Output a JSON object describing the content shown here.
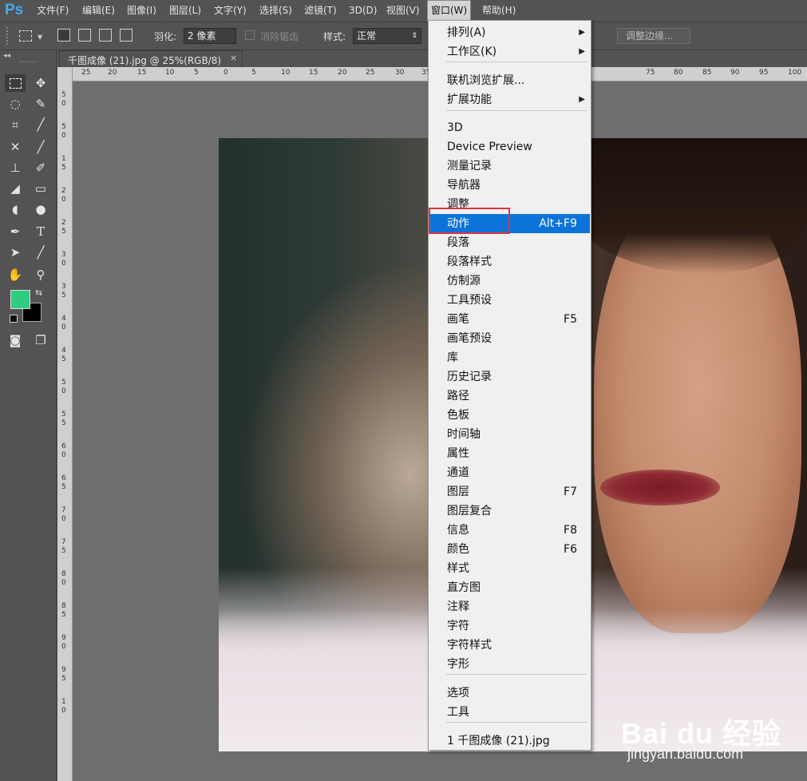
{
  "app": {
    "logo": "Ps"
  },
  "menubar": {
    "items": [
      "文件(F)",
      "编辑(E)",
      "图像(I)",
      "图层(L)",
      "文字(Y)",
      "选择(S)",
      "滤镜(T)",
      "3D(D)",
      "视图(V)",
      "窗口(W)",
      "帮助(H)"
    ],
    "active_index": 9
  },
  "options_bar": {
    "feather_label": "羽化:",
    "feather_value": "2 像素",
    "antialias_label": "消除锯齿",
    "style_label": "样式:",
    "style_value": "正常",
    "refine_edge_button": "调整边缘..."
  },
  "document_tab": {
    "title": "千图成像 (21).jpg @ 25%(RGB/8)",
    "close_symbol": "×"
  },
  "ruler": {
    "h_labels": [
      "25",
      "20",
      "15",
      "10",
      "5",
      "0",
      "5",
      "10",
      "15",
      "20",
      "25",
      "30",
      "35",
      "75",
      "80",
      "85",
      "90",
      "95",
      "100"
    ],
    "v_labels": [
      "5",
      "0",
      "5",
      "0",
      "1",
      "5",
      "2",
      "0",
      "2",
      "5",
      "3",
      "0",
      "3",
      "5",
      "4",
      "0",
      "4",
      "5",
      "5",
      "0",
      "5",
      "5",
      "6",
      "0",
      "6",
      "5",
      "7",
      "0",
      "7",
      "5",
      "8",
      "0",
      "8",
      "5",
      "9",
      "0",
      "9",
      "5",
      "1",
      "0"
    ]
  },
  "window_menu": {
    "items": [
      {
        "label": "排列(A)",
        "submenu": true
      },
      {
        "label": "工作区(K)",
        "submenu": true
      },
      {
        "label": "联机浏览扩展..."
      },
      {
        "label": "扩展功能",
        "submenu": true
      },
      {
        "label": "3D"
      },
      {
        "label": "Device Preview"
      },
      {
        "label": "测量记录"
      },
      {
        "label": "导航器"
      },
      {
        "label": "调整"
      },
      {
        "label": "动作",
        "shortcut": "Alt+F9",
        "highlighted": true
      },
      {
        "label": "段落"
      },
      {
        "label": "段落样式"
      },
      {
        "label": "仿制源"
      },
      {
        "label": "工具预设"
      },
      {
        "label": "画笔",
        "shortcut": "F5"
      },
      {
        "label": "画笔预设"
      },
      {
        "label": "库"
      },
      {
        "label": "历史记录"
      },
      {
        "label": "路径"
      },
      {
        "label": "色板"
      },
      {
        "label": "时间轴"
      },
      {
        "label": "属性"
      },
      {
        "label": "通道"
      },
      {
        "label": "图层",
        "shortcut": "F7"
      },
      {
        "label": "图层复合"
      },
      {
        "label": "信息",
        "shortcut": "F8"
      },
      {
        "label": "颜色",
        "shortcut": "F6"
      },
      {
        "label": "样式"
      },
      {
        "label": "直方图"
      },
      {
        "label": "注释"
      },
      {
        "label": "字符"
      },
      {
        "label": "字符样式"
      },
      {
        "label": "字形"
      },
      {
        "label": "选项"
      },
      {
        "label": "工具"
      },
      {
        "label": "1 千图成像 (21).jpg"
      }
    ],
    "highlight_color": "#0c74d9",
    "annotation_color": "#e0333a"
  },
  "tools": {
    "foreground_color": "#2ecc80",
    "background_color": "#000000"
  },
  "watermark": {
    "brand": "Bai du 经验",
    "site": "jingyan.baidu.com"
  }
}
